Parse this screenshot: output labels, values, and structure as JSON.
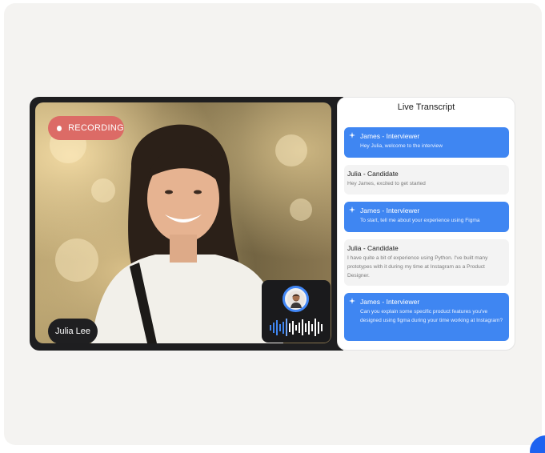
{
  "recording": {
    "label": "RECORDING"
  },
  "participant": {
    "name": "Julia Lee"
  },
  "transcript": {
    "title": "Live Transcript",
    "messages": [
      {
        "speaker": "James - Interviewer",
        "text": "Hey Julia, welcome to the interview",
        "role": "interviewer"
      },
      {
        "speaker": "Julia - Candidate",
        "text": "Hey James, excited to get started",
        "role": "candidate"
      },
      {
        "speaker": "James - Interviewer",
        "text": "To start, tell me about your experience using Figma",
        "role": "interviewer"
      },
      {
        "speaker": "Julia - Candidate",
        "text": "I have quite a bit of experience using Python. I've built many prototypes with it during my time at Instagram as a Product Designer.",
        "role": "candidate"
      },
      {
        "speaker": "James - Interviewer",
        "text": "Can you explain some specific product features you've designed using figma during your time working at Instagram?",
        "role": "interviewer"
      }
    ]
  },
  "colors": {
    "accent": "#3f86f2",
    "recording": "#dc6b66",
    "canvas": "#f4f3f1"
  },
  "icons": [
    "sparkle-icon",
    "recording-dot-icon",
    "audio-waveform-icon",
    "avatar"
  ]
}
